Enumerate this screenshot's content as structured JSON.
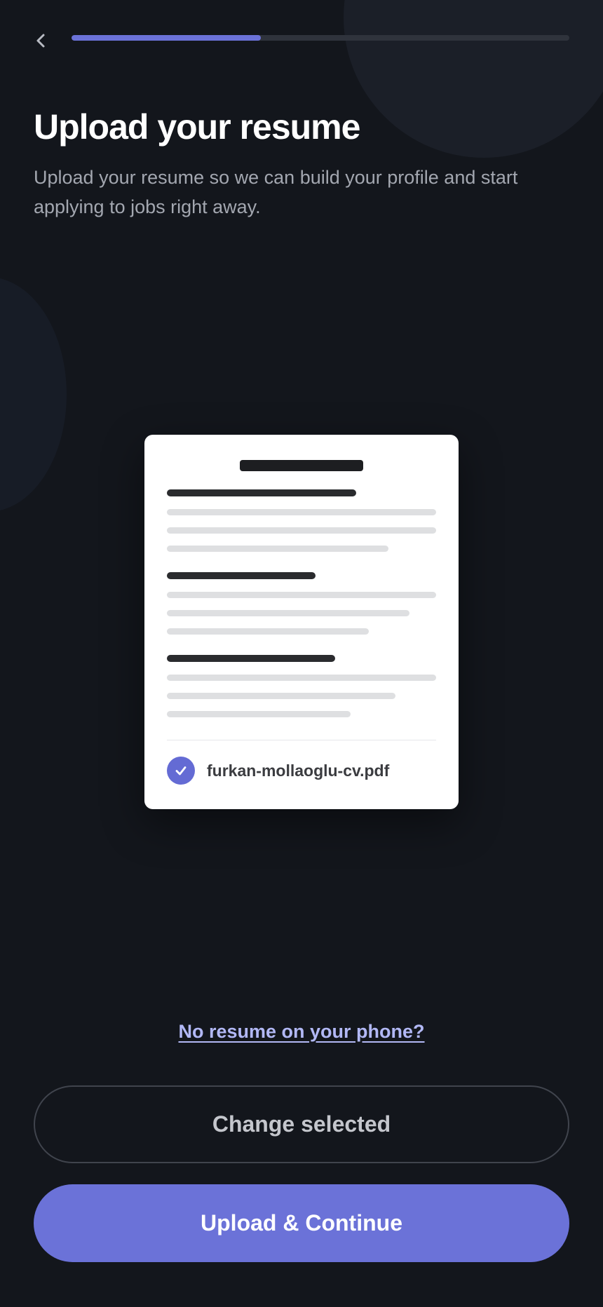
{
  "header": {
    "back_icon": "chevron-left-icon",
    "progress_fraction": 0.38,
    "progress_color": "#6b72d8"
  },
  "content": {
    "title": "Upload your resume",
    "subtitle": "Upload your resume so we can build your profile and start applying to jobs right away."
  },
  "resume_preview": {
    "file_name": "furkan-mollaoglu-cv.pdf",
    "status_icon": "check-circle-icon",
    "status_color": "#646bd4"
  },
  "actions": {
    "no_resume_link": "No resume on your phone?",
    "change_label": "Change selected",
    "upload_label": "Upload & Continue",
    "primary_color": "#6b72d8"
  }
}
